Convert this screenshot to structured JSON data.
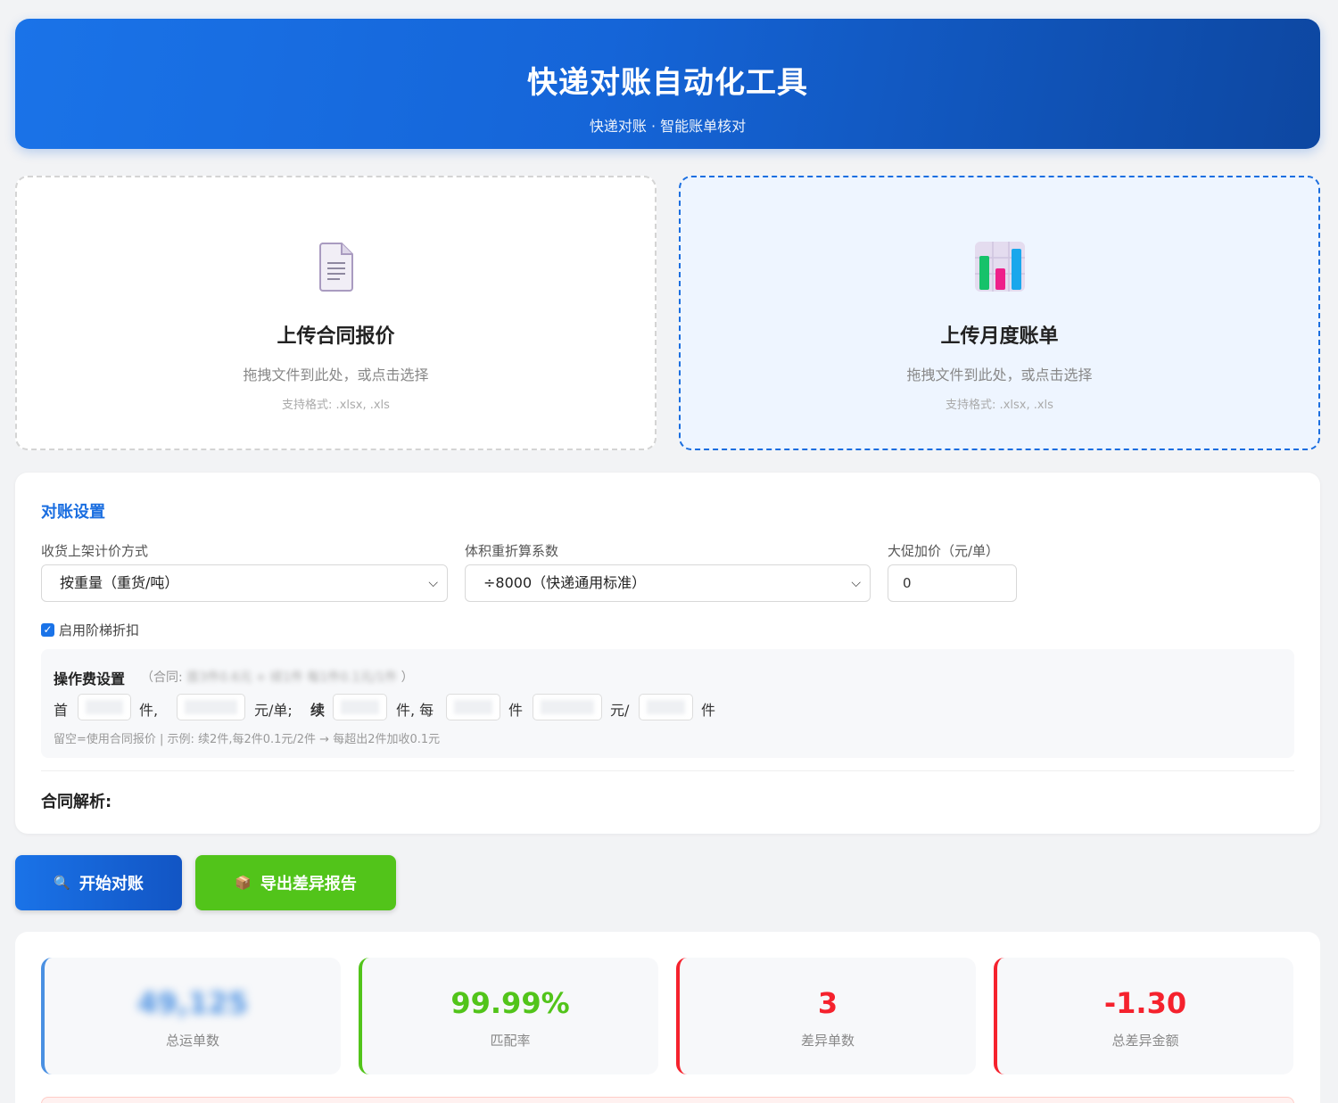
{
  "header": {
    "title": "快递对账自动化工具",
    "subtitle": "快递对账 · 智能账单核对"
  },
  "uploads": {
    "contract": {
      "title": "上传合同报价",
      "hint": "拖拽文件到此处，或点击选择",
      "formats": "支持格式: .xlsx, .xls",
      "icon": "document-icon"
    },
    "bill": {
      "title": "上传月度账单",
      "hint": "拖拽文件到此处，或点击选择",
      "formats": "支持格式: .xlsx, .xls",
      "icon": "bar-chart-icon"
    }
  },
  "settings": {
    "title": "对账设置",
    "pricing_label": "收货上架计价方式",
    "pricing_value": "按重量（重货/吨）",
    "volume_label": "体积重折算系数",
    "volume_value": "÷8000（快递通用标准）",
    "promo_label": "大促加价（元/单）",
    "promo_value": "0",
    "tier_label": "启用阶梯折扣",
    "tier_checked": true,
    "opfee": {
      "title": "操作费设置",
      "sub_prefix": "（合同:",
      "sub_blurred": "首3件0.6元 + 续1件 每1件0.1元/1件",
      "sub_suffix": "）",
      "first": "首",
      "pieces1": "件,",
      "yuan_per_order": "元/单;",
      "cont": "续",
      "pieces_each": "件, 每",
      "pieces2": "件",
      "yuan_slash": "元/",
      "pieces3": "件",
      "note": "留空=使用合同报价 | 示例: 续2件,每2件0.1元/2件 → 每超出2件加收0.1元"
    },
    "parse_label": "合同解析:"
  },
  "actions": {
    "start_label": "开始对账",
    "export_label": "导出差异报告"
  },
  "stats": {
    "total_orders_value": "49,125",
    "total_orders_label": "总运单数",
    "match_rate_value": "99.99%",
    "match_rate_label": "匹配率",
    "diff_count_value": "3",
    "diff_count_label": "差异单数",
    "diff_amount_value": "-1.30",
    "diff_amount_label": "总差异金额"
  },
  "colors": {
    "primary": "#1a73e8",
    "success": "#52c41a",
    "danger": "#f5222d"
  }
}
